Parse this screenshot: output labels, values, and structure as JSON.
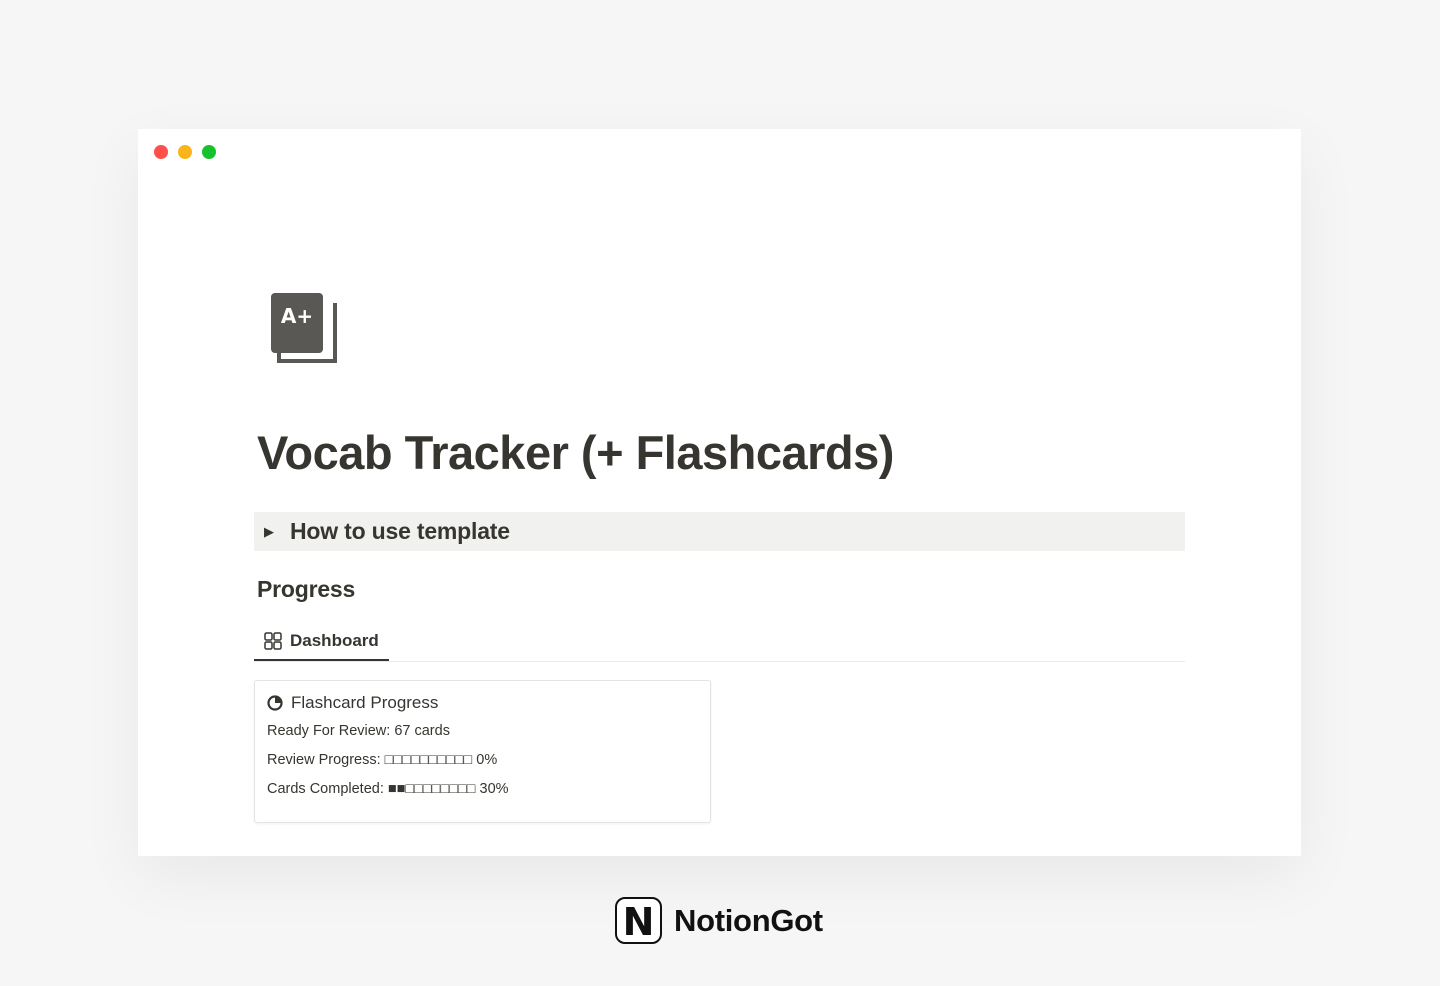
{
  "window": {
    "controls": [
      "close",
      "minimize",
      "maximize"
    ]
  },
  "page": {
    "icon": "a-plus-stack-icon",
    "icon_text": "A+",
    "title": "Vocab Tracker (+ Flashcards)"
  },
  "toggle": {
    "label": "How to use template"
  },
  "progress": {
    "heading": "Progress",
    "tabs": [
      {
        "label": "Dashboard",
        "icon": "gallery-grid-icon",
        "active": true
      }
    ]
  },
  "card": {
    "title": "Flashcard Progress",
    "icon": "pie-progress-icon",
    "rows": [
      {
        "label": "Ready For Review:",
        "value": "67 cards"
      },
      {
        "label": "Review Progress:",
        "bar": "□□□□□□□□□□",
        "percent": "0%"
      },
      {
        "label": "Cards Completed:",
        "bar": "■■□□□□□□□□",
        "percent": "30%"
      }
    ]
  },
  "brand": {
    "logo_letter": "N",
    "name": "NotionGot"
  },
  "colors": {
    "close": "#fe4f4a",
    "minimize": "#fbb41a",
    "maximize": "#17c02d",
    "text": "#37352f",
    "toggle_bg": "#f1f1ef"
  }
}
